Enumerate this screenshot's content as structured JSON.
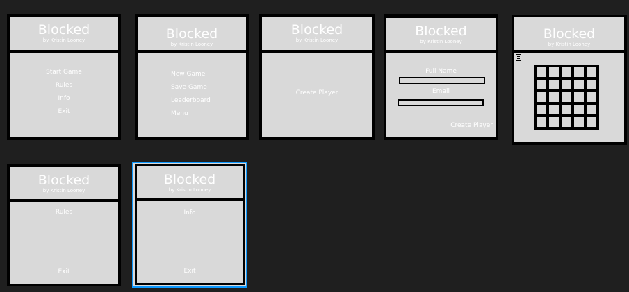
{
  "app": {
    "title": "Blocked",
    "byline": "by Kristin Looney"
  },
  "frames": {
    "main_menu": {
      "items": [
        "Start Game",
        "Rules",
        "Info",
        "Exit"
      ]
    },
    "game_menu": {
      "items": [
        "New Game",
        "Save Game",
        "Leaderboard",
        "Menu"
      ]
    },
    "create_player_start": {
      "button": "Create Player"
    },
    "create_player_form": {
      "full_name_label": "Full Name",
      "email_label": "Email",
      "button": "Create Player"
    },
    "game_board": {
      "rows": 5,
      "cols": 5
    },
    "rules": {
      "heading": "Rules",
      "exit": "Exit"
    },
    "info": {
      "heading": "Info",
      "exit": "Exit"
    }
  },
  "colors": {
    "canvas": "#1f1f1f",
    "frame_fill": "#d9d9d9",
    "border": "#000000",
    "selection": "#0d99ff",
    "text": "#ffffff"
  }
}
